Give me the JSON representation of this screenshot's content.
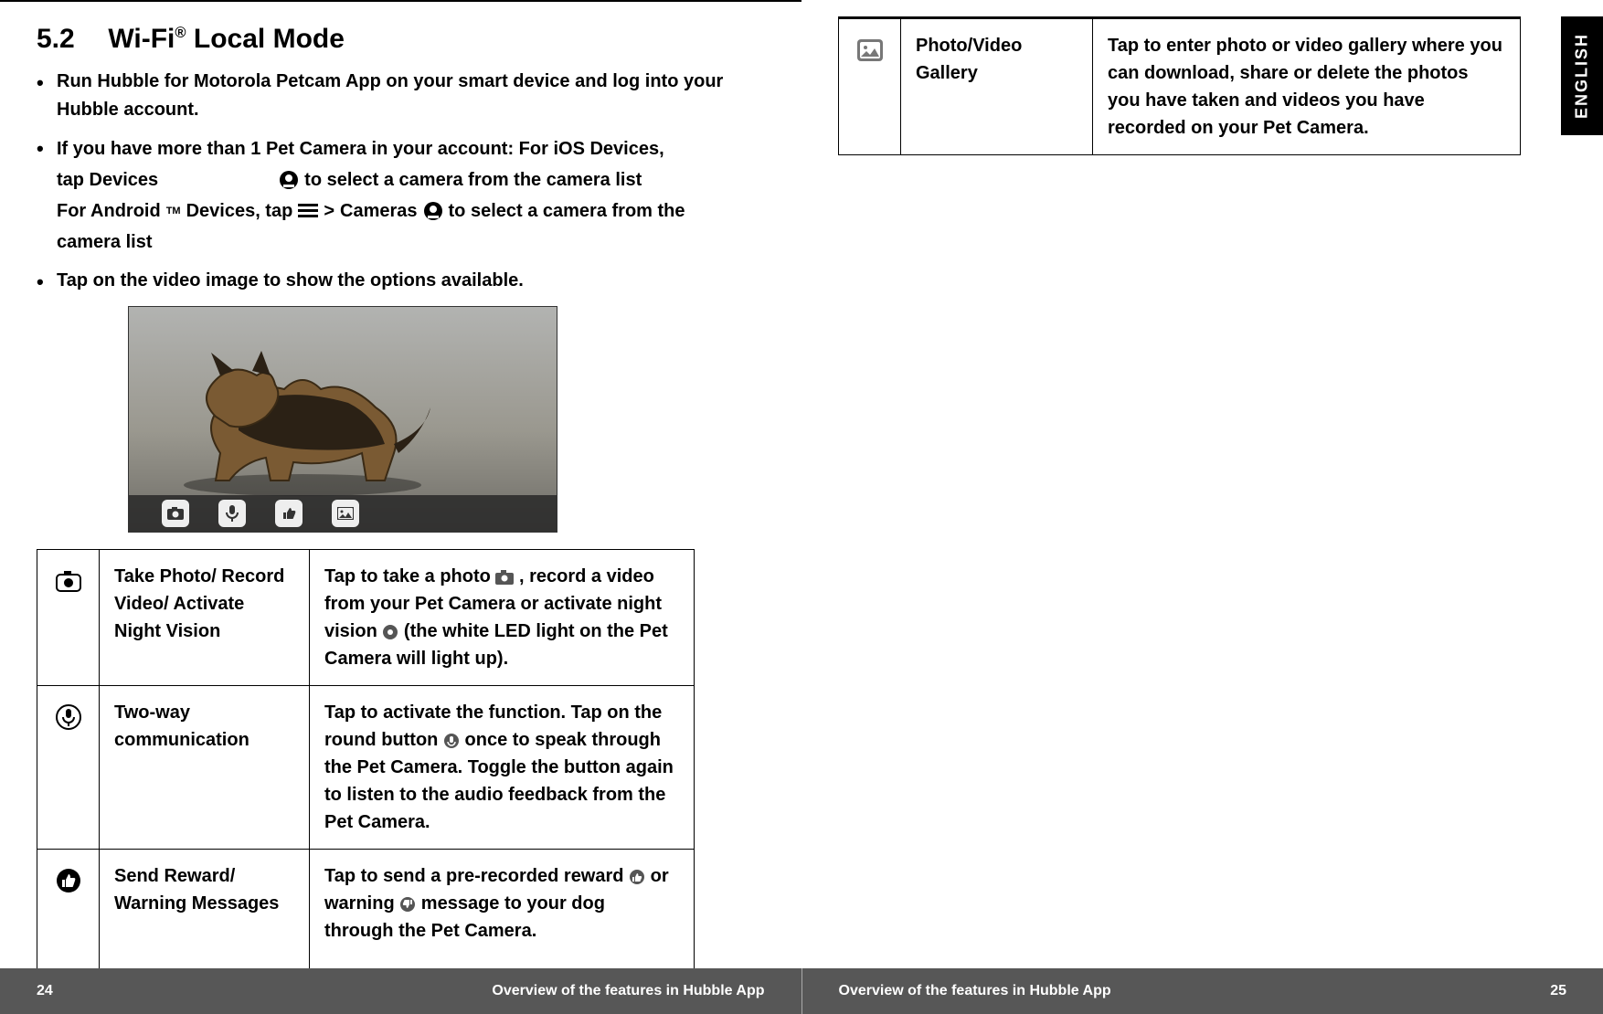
{
  "lang_tab": "ENGLISH",
  "heading_number": "5.2",
  "heading_text_pre": "Wi-Fi",
  "heading_sup": "®",
  "heading_text_post": " Local Mode",
  "bullets": {
    "b1": "Run Hubble for Motorola Petcam App on your smart device and log into your Hubble account.",
    "b2_intro": "If you have more than 1 Pet Camera in your account: For iOS Devices,",
    "b2_tap": "tap Devices",
    "b2_after_icon1": "to select a camera from the camera list",
    "b2_android_pre": "For Android",
    "b2_android_tm": "TM",
    "b2_android_post": " Devices, tap",
    "b2_gt": ">",
    "b2_cameras": "Cameras",
    "b2_after_icon2": "to select a camera from the",
    "b2_cameralist": "camera list",
    "b3": "Tap on the video image to show the options available."
  },
  "table_left": {
    "r1_label": "Take Photo/ Record Video/ Activate Night Vision",
    "r1_desc_a": "Tap to take a photo",
    "r1_desc_b": ", record a video from your Pet Camera or activate night vision",
    "r1_desc_c": "(the white LED light on the Pet Camera will light up).",
    "r2_label": "Two-way communication",
    "r2_desc_a": "Tap to activate the function. Tap on the round button",
    "r2_desc_b": "once to speak through the Pet Camera. Toggle the button again to listen to the audio feedback from the Pet Camera.",
    "r3_label": "Send Reward/ Warning Messages",
    "r3_desc_a": "Tap to send a pre-recorded reward",
    "r3_desc_b": "or warning",
    "r3_desc_c": "message to your dog through the Pet Camera."
  },
  "table_right": {
    "r1_label": "Photo/Video Gallery",
    "r1_desc": "Tap to enter photo or video gallery where you can download, share or delete the photos you have taken and videos you have recorded on your Pet Camera."
  },
  "footer": {
    "left_page": "24",
    "left_text": "Overview of the features in Hubble App",
    "right_text": "Overview of the features in Hubble App",
    "right_page": "25"
  }
}
